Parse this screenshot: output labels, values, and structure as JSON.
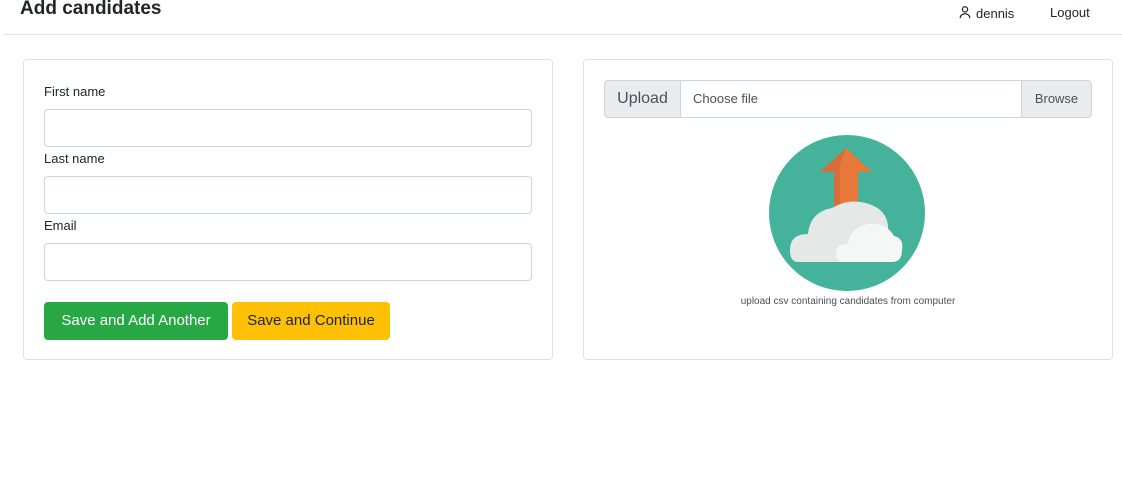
{
  "header": {
    "title": "Add candidates",
    "user_name": "dennis",
    "logout_label": "Logout"
  },
  "form": {
    "first_name_label": "First name",
    "first_name_value": "",
    "last_name_label": "Last name",
    "last_name_value": "",
    "email_label": "Email",
    "email_value": "",
    "save_add_another_label": "Save and Add Another",
    "save_continue_label": "Save and Continue"
  },
  "upload": {
    "prepend_label": "Upload",
    "file_placeholder": "Choose file",
    "browse_label": "Browse",
    "caption": "upload csv containing candidates from computer",
    "illustration_icon": "cloud-upload-icon"
  },
  "colors": {
    "success": "#28a745",
    "warning": "#ffc107",
    "illustration_circle": "#45b39c",
    "illustration_arrow": "#e8793a"
  }
}
